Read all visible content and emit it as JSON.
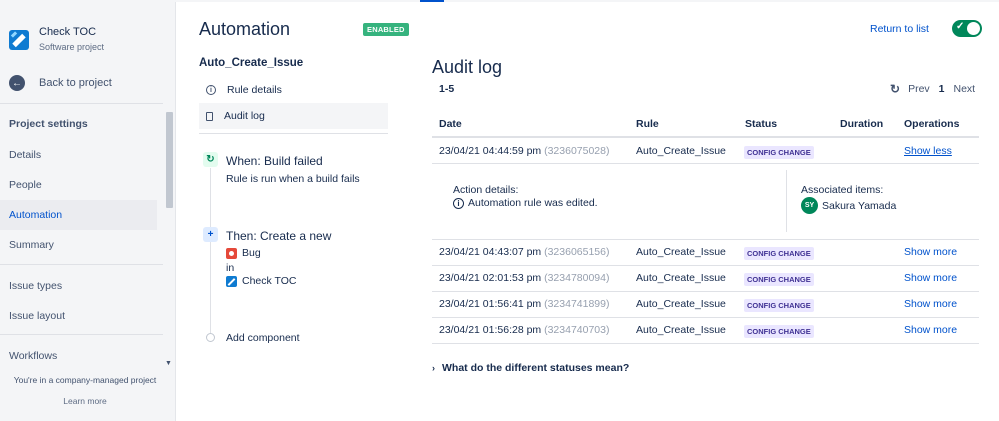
{
  "sidebar": {
    "project_name": "Check TOC",
    "project_type": "Software project",
    "back_label": "Back to project",
    "section_title": "Project settings",
    "items": [
      {
        "label": "Details"
      },
      {
        "label": "People"
      },
      {
        "label": "Automation"
      },
      {
        "label": "Summary"
      },
      {
        "label": "Issue types"
      },
      {
        "label": "Issue layout"
      },
      {
        "label": "Workflows"
      }
    ],
    "footer_text": "You're in a company-managed project",
    "learn_more": "Learn more"
  },
  "rule_panel": {
    "title": "Automation",
    "enabled_badge": "ENABLED",
    "rule_name": "Auto_Create_Issue",
    "menu": [
      {
        "label": "Rule details",
        "icon": "info-icon"
      },
      {
        "label": "Audit log",
        "icon": "document-icon"
      }
    ],
    "trigger": {
      "icon": "refresh-icon",
      "title": "When: Build failed",
      "description": "Rule is run when a build fails"
    },
    "action": {
      "icon": "plus-icon",
      "title": "Then: Create a new",
      "issue_type": "Bug",
      "in_label": "in",
      "project": "Check TOC"
    },
    "add_component": "Add component"
  },
  "header": {
    "return_link": "Return to list",
    "toggle_on": true
  },
  "audit": {
    "title": "Audit log",
    "range": "1-5",
    "pager": {
      "prev": "Prev",
      "current": "1",
      "next": "Next"
    },
    "columns": [
      "Date",
      "Rule",
      "Status",
      "Duration",
      "Operations"
    ],
    "rows": [
      {
        "date": "23/04/21 04:44:59 pm",
        "id": "(3236075028)",
        "rule": "Auto_Create_Issue",
        "status": "CONFIG CHANGE",
        "duration": "",
        "operation": "Show less"
      },
      {
        "date": "23/04/21 04:43:07 pm",
        "id": "(3236065156)",
        "rule": "Auto_Create_Issue",
        "status": "CONFIG CHANGE",
        "duration": "",
        "operation": "Show more"
      },
      {
        "date": "23/04/21 02:01:53 pm",
        "id": "(3234780094)",
        "rule": "Auto_Create_Issue",
        "status": "CONFIG CHANGE",
        "duration": "",
        "operation": "Show more"
      },
      {
        "date": "23/04/21 01:56:41 pm",
        "id": "(3234741899)",
        "rule": "Auto_Create_Issue",
        "status": "CONFIG CHANGE",
        "duration": "",
        "operation": "Show more"
      },
      {
        "date": "23/04/21 01:56:28 pm",
        "id": "(3234740703)",
        "rule": "Auto_Create_Issue",
        "status": "CONFIG CHANGE",
        "duration": "",
        "operation": "Show more"
      }
    ],
    "details": {
      "action_heading": "Action details:",
      "action_text": "Automation rule was edited.",
      "items_heading": "Associated items:",
      "user_initials": "SY",
      "user_name": "Sakura Yamada"
    },
    "faq": "What do the different statuses mean?"
  },
  "colors": {
    "link": "#0052cc",
    "enabled": "#36b37e",
    "toggle": "#00875a",
    "badge_bg": "#eae6ff",
    "badge_text": "#403294"
  }
}
